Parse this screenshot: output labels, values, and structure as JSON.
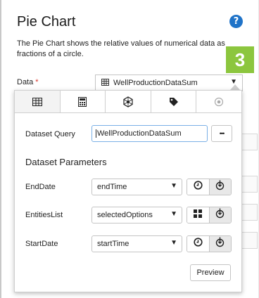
{
  "header": {
    "title": "Pie Chart",
    "help_icon": "question-circle-icon",
    "description": "The Pie Chart shows the relative values of numerical data as fractions of a circle.",
    "step_number": "3",
    "step_color": "#8cc63e"
  },
  "data_field": {
    "label": "Data",
    "required_mark": "*",
    "value": "WellProductionDataSum",
    "icon": "table-icon"
  },
  "tabs": [
    {
      "icon": "table-icon",
      "active": true
    },
    {
      "icon": "calculator-icon",
      "active": false
    },
    {
      "icon": "entity-hub-icon",
      "active": false
    },
    {
      "icon": "tag-icon",
      "active": false
    },
    {
      "icon": "radio-circle-icon",
      "active": false
    }
  ],
  "dataset_query": {
    "label": "Dataset Query",
    "value": "WellProductionDataSum",
    "more_label": "•••"
  },
  "parameters": {
    "title": "Dataset Parameters",
    "rows": [
      {
        "label": "EndDate",
        "value": "endTime",
        "left_icon": "clock-icon",
        "right_icon": "down-arrow-circle-icon"
      },
      {
        "label": "EntitiesList",
        "value": "selectedOptions",
        "left_icon": "grid-icon",
        "right_icon": "down-arrow-circle-icon"
      },
      {
        "label": "StartDate",
        "value": "startTime",
        "left_icon": "clock-icon",
        "right_icon": "down-arrow-circle-icon"
      }
    ]
  },
  "preview_label": "Preview",
  "colors": {
    "accent_blue": "#1f73c8",
    "required": "#d9342b",
    "input_focus": "#7ab0e6"
  }
}
